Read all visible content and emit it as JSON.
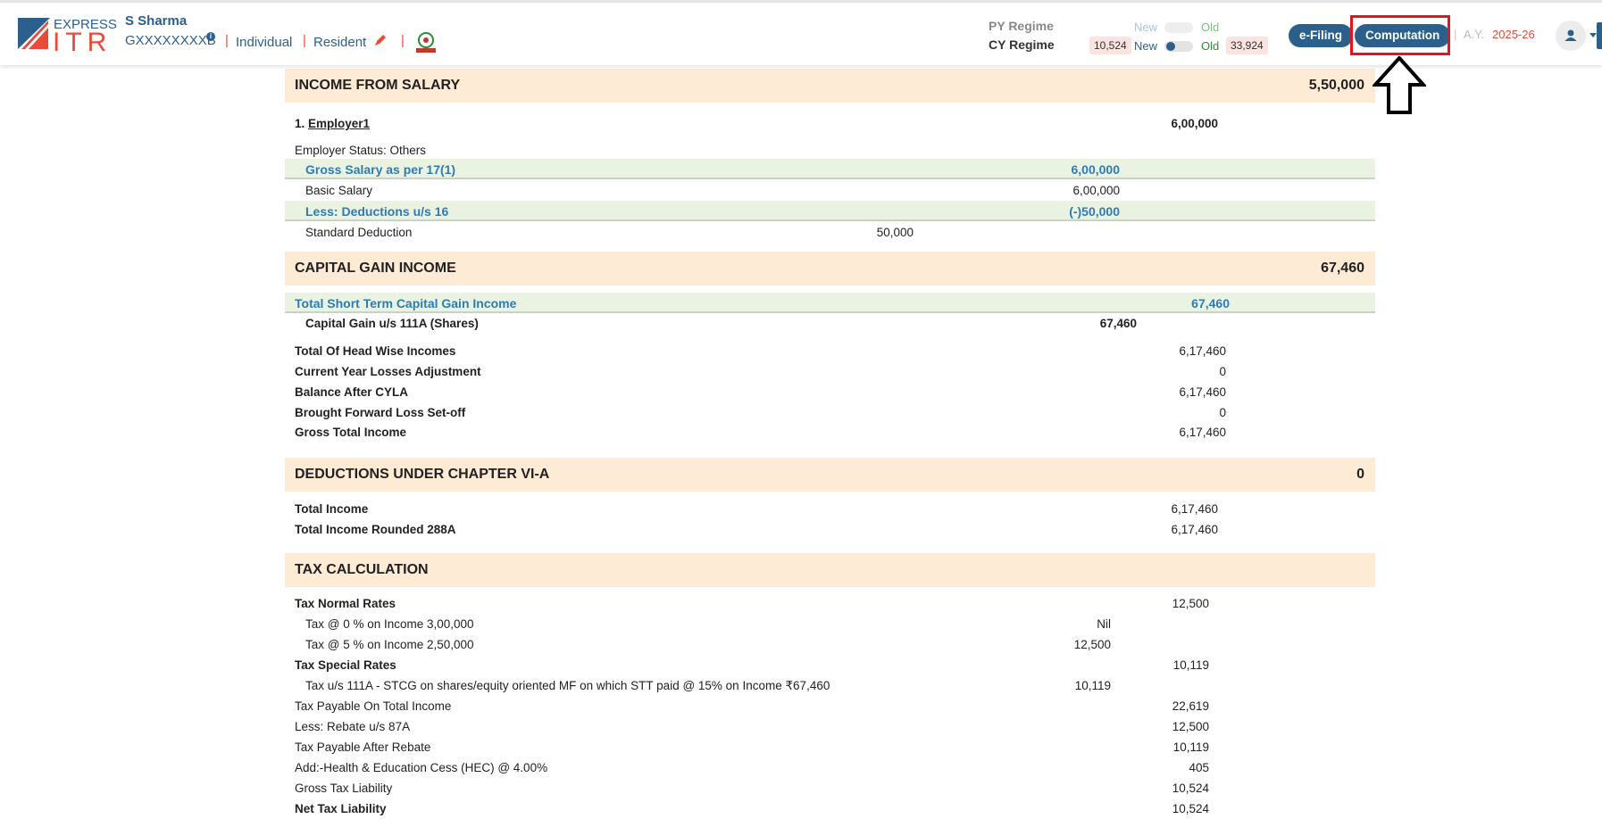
{
  "header": {
    "logo": {
      "word1": "EXPRESS",
      "word2": "ITR"
    },
    "user": {
      "name": "S Sharma",
      "pan": "GXXXXXXXXB",
      "info_icon_glyph": "i",
      "type": "Individual",
      "residency": "Resident",
      "separator": "|"
    },
    "regime": {
      "py_label": "PY Regime",
      "cy_label": "CY Regime",
      "new_label": "New",
      "old_label": "Old",
      "cy_new_amount": "10,524",
      "cy_old_amount": "33,924"
    },
    "buttons": {
      "efiling": "e-Filing",
      "computation": "Computation"
    },
    "ay": {
      "label": "A.Y.",
      "value": "2025-26",
      "separator": "|"
    }
  },
  "computation": {
    "salary": {
      "title": "INCOME FROM SALARY",
      "total": "5,50,000",
      "employer_number": "1.",
      "employer_name": "Employer1",
      "employer_total": "6,00,000",
      "employer_status": "Employer Status: Others",
      "gross_label": "Gross Salary as per 17(1)",
      "gross_value": "6,00,000",
      "basic_label": "Basic Salary",
      "basic_value": "6,00,000",
      "deductions_label": "Less: Deductions u/s 16",
      "deductions_value": "(-)50,000",
      "std_label": "Standard Deduction",
      "std_value": "50,000"
    },
    "capital_gain": {
      "title": "CAPITAL GAIN INCOME",
      "total": "67,460",
      "stcg_label": "Total Short Term Capital Gain Income",
      "stcg_value": "67,460",
      "shares_label": "Capital Gain u/s 111A (Shares)",
      "shares_value": "67,460"
    },
    "summary": [
      {
        "label": "Total Of Head Wise Incomes",
        "value": "6,17,460"
      },
      {
        "label": "Current Year Losses Adjustment",
        "value": "0"
      },
      {
        "label": "Balance After CYLA",
        "value": "6,17,460"
      },
      {
        "label": "Brought Forward Loss Set-off",
        "value": "0"
      },
      {
        "label": "Gross Total Income",
        "value": "6,17,460"
      }
    ],
    "deductions": {
      "title": "DEDUCTIONS UNDER CHAPTER VI-A",
      "total": "0"
    },
    "total_income": [
      {
        "label": "Total Income",
        "value": "6,17,460"
      },
      {
        "label": "Total Income Rounded 288A",
        "value": "6,17,460"
      }
    ],
    "tax": {
      "title": "TAX CALCULATION",
      "normal_label": "Tax Normal Rates",
      "normal_value": "12,500",
      "slab1_label": "Tax @ 0 % on Income 3,00,000",
      "slab1_value": "Nil",
      "slab2_label": "Tax @ 5 % on Income 2,50,000",
      "slab2_value": "12,500",
      "special_label": "Tax Special Rates",
      "special_value": "10,119",
      "special_item_label": "Tax u/s 111A - STCG on shares/equity oriented MF on which STT paid @ 15% on Income ₹67,460",
      "special_item_value": "10,119",
      "lines": [
        {
          "label": "Tax Payable On Total Income",
          "value": "22,619"
        },
        {
          "label": "Less: Rebate u/s 87A",
          "value": "12,500"
        },
        {
          "label": "Tax Payable After Rebate",
          "value": "10,119"
        },
        {
          "label": "Add:-Health & Education Cess (HEC) @ 4.00%",
          "value": "405"
        },
        {
          "label": "Gross Tax Liability",
          "value": "10,524"
        }
      ],
      "net_label": "Net Tax Liability",
      "net_value": "10,524"
    }
  }
}
